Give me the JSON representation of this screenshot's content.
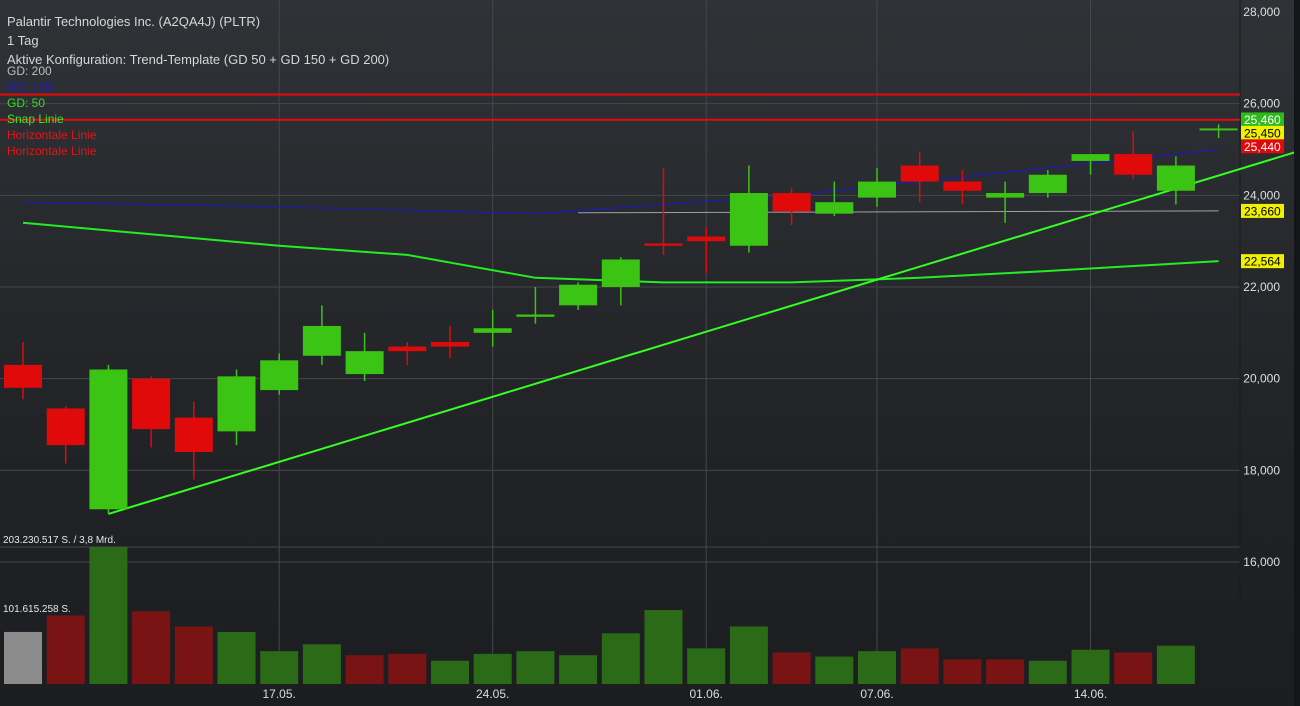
{
  "header": {
    "instrument": "Palantir Technologies Inc. (A2QA4J) (PLTR)",
    "interval": "1 Tag",
    "config": "Aktive Konfiguration: Trend-Template (GD 50 + GD 150 + GD 200)"
  },
  "legend": [
    {
      "label": "GD: 200",
      "color": "#bdbdbd"
    },
    {
      "label": "GD: 150",
      "color": "#2020c0"
    },
    {
      "label": "GD: 50",
      "color": "#33dd22"
    },
    {
      "label": "Snap Linie",
      "color": "#33ee22"
    },
    {
      "label": "Horizontale Linie",
      "color": "#ee1111"
    },
    {
      "label": "Horizontale Linie",
      "color": "#ee1111"
    }
  ],
  "volume_labels": {
    "max": "203.230.517 S. / 3,8 Mrd.",
    "mid": "101.615.258 S."
  },
  "chart_data": {
    "type": "candlestick",
    "ylim": [
      16000,
      28000
    ],
    "y_ticks": [
      16000,
      18000,
      20000,
      22000,
      24000,
      26000,
      28000
    ],
    "y_tick_labels": [
      "16,000",
      "18,000",
      "20,000",
      "22,000",
      "24,000",
      "26,000",
      "28,000"
    ],
    "x_ticks": [
      {
        "index": 6,
        "label": "17.05."
      },
      {
        "index": 11,
        "label": "24.05."
      },
      {
        "index": 16,
        "label": "01.06."
      },
      {
        "index": 20,
        "label": "07.06."
      },
      {
        "index": 25,
        "label": "14.06."
      }
    ],
    "candles": [
      {
        "o": 19800,
        "h": 20800,
        "l": 19550,
        "c": 20300,
        "dir": "down"
      },
      {
        "o": 19350,
        "h": 19400,
        "l": 18150,
        "c": 18550,
        "dir": "down"
      },
      {
        "o": 17150,
        "h": 20300,
        "l": 17050,
        "c": 20200,
        "dir": "up"
      },
      {
        "o": 20000,
        "h": 20050,
        "l": 18500,
        "c": 18900,
        "dir": "down"
      },
      {
        "o": 19150,
        "h": 19500,
        "l": 17800,
        "c": 18400,
        "dir": "down"
      },
      {
        "o": 18850,
        "h": 20200,
        "l": 18550,
        "c": 20050,
        "dir": "up"
      },
      {
        "o": 19750,
        "h": 20550,
        "l": 19650,
        "c": 20400,
        "dir": "up"
      },
      {
        "o": 20500,
        "h": 21600,
        "l": 20300,
        "c": 21150,
        "dir": "up"
      },
      {
        "o": 20100,
        "h": 21000,
        "l": 19950,
        "c": 20600,
        "dir": "up"
      },
      {
        "o": 20700,
        "h": 20800,
        "l": 20300,
        "c": 20600,
        "dir": "down"
      },
      {
        "o": 20800,
        "h": 21150,
        "l": 20450,
        "c": 20700,
        "dir": "down"
      },
      {
        "o": 21000,
        "h": 21500,
        "l": 20700,
        "c": 21100,
        "dir": "up"
      },
      {
        "o": 21350,
        "h": 22000,
        "l": 21200,
        "c": 21400,
        "dir": "up"
      },
      {
        "o": 21600,
        "h": 22100,
        "l": 21500,
        "c": 22050,
        "dir": "up"
      },
      {
        "o": 22000,
        "h": 22650,
        "l": 21600,
        "c": 22600,
        "dir": "up"
      },
      {
        "o": 22950,
        "h": 24600,
        "l": 22700,
        "c": 22900,
        "dir": "down"
      },
      {
        "o": 23100,
        "h": 23300,
        "l": 22300,
        "c": 23000,
        "dir": "down"
      },
      {
        "o": 22900,
        "h": 24650,
        "l": 22750,
        "c": 24050,
        "dir": "up"
      },
      {
        "o": 24050,
        "h": 24150,
        "l": 23350,
        "c": 23650,
        "dir": "down"
      },
      {
        "o": 23600,
        "h": 24300,
        "l": 23550,
        "c": 23850,
        "dir": "up"
      },
      {
        "o": 23950,
        "h": 24600,
        "l": 23750,
        "c": 24300,
        "dir": "up"
      },
      {
        "o": 24650,
        "h": 24950,
        "l": 23850,
        "c": 24300,
        "dir": "down"
      },
      {
        "o": 24300,
        "h": 24550,
        "l": 23800,
        "c": 24100,
        "dir": "down"
      },
      {
        "o": 23950,
        "h": 24300,
        "l": 23400,
        "c": 24050,
        "dir": "up"
      },
      {
        "o": 24050,
        "h": 24550,
        "l": 23950,
        "c": 24450,
        "dir": "up"
      },
      {
        "o": 24750,
        "h": 24850,
        "l": 24450,
        "c": 24900,
        "dir": "up"
      },
      {
        "o": 24900,
        "h": 25400,
        "l": 24350,
        "c": 24450,
        "dir": "down"
      },
      {
        "o": 24100,
        "h": 24850,
        "l": 23800,
        "c": 24650,
        "dir": "up"
      },
      {
        "o": 25450,
        "h": 25550,
        "l": 25250,
        "c": 25460,
        "dir": "up"
      }
    ],
    "volume": [
      {
        "v": 0.38,
        "kind": "gray"
      },
      {
        "v": 0.5,
        "kind": "red"
      },
      {
        "v": 1.0,
        "kind": "green"
      },
      {
        "v": 0.53,
        "kind": "red"
      },
      {
        "v": 0.42,
        "kind": "red"
      },
      {
        "v": 0.38,
        "kind": "green"
      },
      {
        "v": 0.24,
        "kind": "green"
      },
      {
        "v": 0.29,
        "kind": "green"
      },
      {
        "v": 0.21,
        "kind": "red"
      },
      {
        "v": 0.22,
        "kind": "red"
      },
      {
        "v": 0.17,
        "kind": "green"
      },
      {
        "v": 0.22,
        "kind": "green"
      },
      {
        "v": 0.24,
        "kind": "green"
      },
      {
        "v": 0.21,
        "kind": "green"
      },
      {
        "v": 0.37,
        "kind": "green"
      },
      {
        "v": 0.54,
        "kind": "green"
      },
      {
        "v": 0.26,
        "kind": "green"
      },
      {
        "v": 0.42,
        "kind": "green"
      },
      {
        "v": 0.23,
        "kind": "red"
      },
      {
        "v": 0.2,
        "kind": "green"
      },
      {
        "v": 0.24,
        "kind": "green"
      },
      {
        "v": 0.26,
        "kind": "red"
      },
      {
        "v": 0.18,
        "kind": "red"
      },
      {
        "v": 0.18,
        "kind": "red"
      },
      {
        "v": 0.17,
        "kind": "green"
      },
      {
        "v": 0.25,
        "kind": "green"
      },
      {
        "v": 0.23,
        "kind": "red"
      },
      {
        "v": 0.28,
        "kind": "green"
      }
    ],
    "gd150": [
      {
        "i": 0,
        "y": 23850
      },
      {
        "i": 6,
        "y": 23750
      },
      {
        "i": 12,
        "y": 23600
      },
      {
        "i": 18,
        "y": 24000
      },
      {
        "i": 24,
        "y": 24600
      },
      {
        "i": 28,
        "y": 25000
      }
    ],
    "gd200": [
      {
        "i": 13,
        "y": 23620
      },
      {
        "i": 28,
        "y": 23660
      }
    ],
    "gd50": [
      {
        "i": 0,
        "y": 23400
      },
      {
        "i": 3,
        "y": 23150
      },
      {
        "i": 6,
        "y": 22900
      },
      {
        "i": 9,
        "y": 22700
      },
      {
        "i": 12,
        "y": 22200
      },
      {
        "i": 15,
        "y": 22100
      },
      {
        "i": 18,
        "y": 22100
      },
      {
        "i": 21,
        "y": 22200
      },
      {
        "i": 24,
        "y": 22350
      },
      {
        "i": 28,
        "y": 22564
      }
    ],
    "snap_line": [
      {
        "i": 2,
        "y": 17050
      },
      {
        "i": 30,
        "y": 25000
      }
    ],
    "horizontal_lines": [
      26200,
      25650
    ],
    "price_tags": [
      {
        "label": "25,460",
        "value": 25460,
        "bg": "#2dbb1a",
        "fg": "#ffffff",
        "offset": -9
      },
      {
        "label": "25,450",
        "value": 25450,
        "bg": "#f0f000",
        "fg": "#000000",
        "offset": 4
      },
      {
        "label": "25,440",
        "value": 25440,
        "bg": "#dd0a0a",
        "fg": "#ffffff",
        "offset": 17
      },
      {
        "label": "23,660",
        "value": 23660,
        "bg": "#f0f000",
        "fg": "#000000",
        "offset": 0
      },
      {
        "label": "22,564",
        "value": 22564,
        "bg": "#f0f000",
        "fg": "#000000",
        "offset": 0
      }
    ],
    "colors": {
      "up": "#3cc414",
      "down": "#e00a0a",
      "vol_up": "#2b6a16",
      "vol_down": "#7a1414",
      "vol_gray": "#8c8c8c",
      "grid": "#44474c",
      "axis_text": "#dedede",
      "gd150": "#1c1cb4",
      "gd200": "#a0a0a0",
      "gd50": "#22ee22",
      "snap": "#33ff22",
      "hline": "#e80a0a"
    }
  }
}
